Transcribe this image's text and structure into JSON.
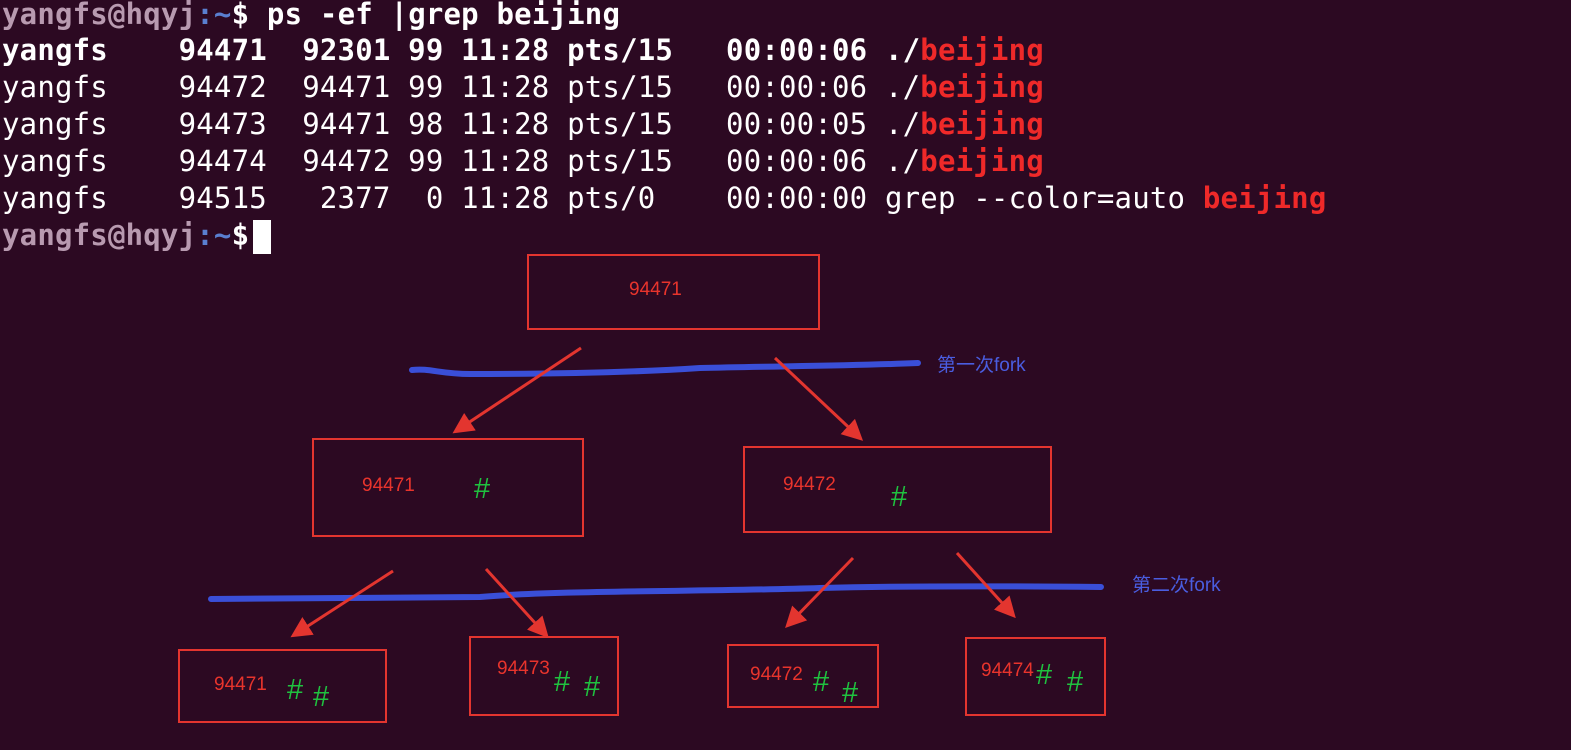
{
  "terminal": {
    "prompt": {
      "user_host": "yangfs@hqyj",
      "path": ":~",
      "symbol": "$"
    },
    "command": " ps -ef |grep beijing",
    "rows": [
      {
        "text": "yangfs    94471  92301 99 11:28 pts/15   00:00:06 ./",
        "match": "beijing",
        "bold": true
      },
      {
        "text": "yangfs    94472  94471 99 11:28 pts/15   00:00:06 ./",
        "match": "beijing",
        "bold": false
      },
      {
        "text": "yangfs    94473  94471 98 11:28 pts/15   00:00:05 ./",
        "match": "beijing",
        "bold": false
      },
      {
        "text": "yangfs    94474  94472 99 11:28 pts/15   00:00:06 ./",
        "match": "beijing",
        "bold": false
      },
      {
        "text": "yangfs    94515   2377  0 11:28 pts/0    00:00:00 grep --color=auto ",
        "match": "beijing",
        "bold": false
      }
    ]
  },
  "diagram": {
    "root": {
      "pid": "94471"
    },
    "first_fork_label": "第一次fork",
    "second_fork_label": "第二次fork",
    "level1": [
      {
        "pid": "94471",
        "marks": "#"
      },
      {
        "pid": "94472",
        "marks": "#"
      }
    ],
    "level2": [
      {
        "pid": "94471",
        "marks": [
          "#",
          "#"
        ]
      },
      {
        "pid": "94473",
        "marks": [
          "#",
          "#"
        ]
      },
      {
        "pid": "94472",
        "marks": [
          "#",
          "#"
        ]
      },
      {
        "pid": "94474",
        "marks": [
          "#",
          "#"
        ]
      }
    ]
  },
  "colors": {
    "background": "#2c0922",
    "box_border": "#e3352f",
    "pid_text": "#e8342c",
    "hash": "#1fc23f",
    "fork_line": "#3a4fd8",
    "match": "#ef2929"
  }
}
